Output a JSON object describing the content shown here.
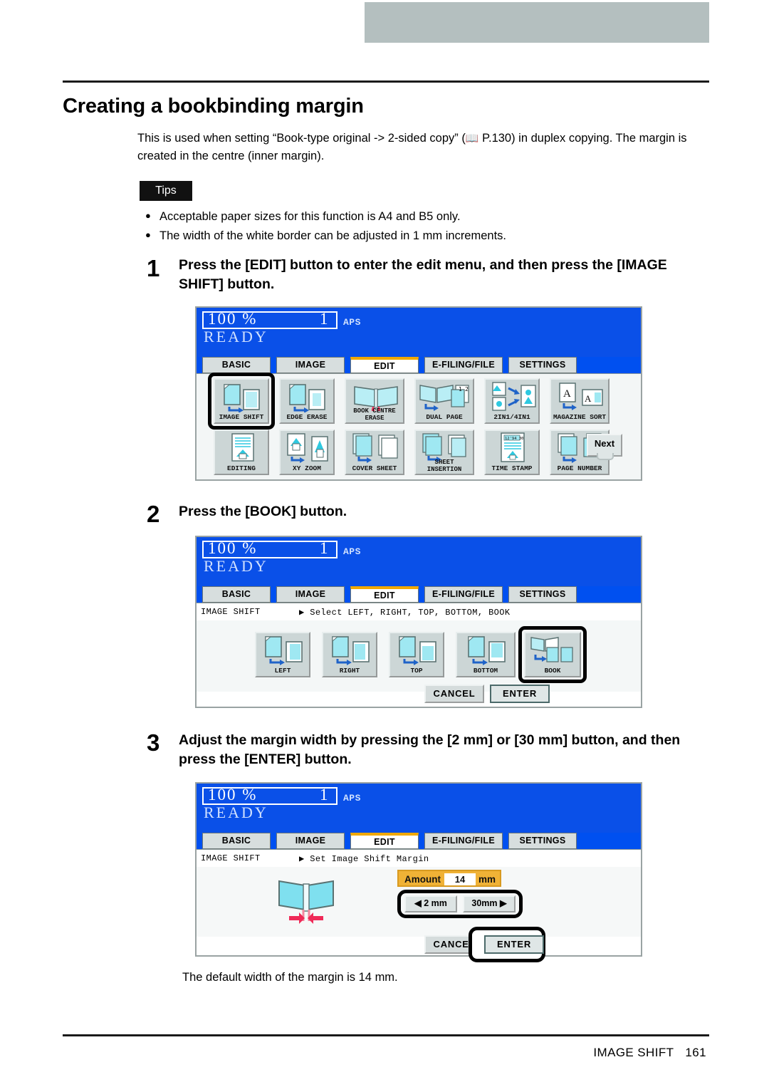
{
  "page_title": "Creating a bookbinding margin",
  "intro": "This is used when setting “Book-type original -> 2-sided copy” (  P.130) in duplex copying. The margin is created in the centre (inner margin).",
  "tips": {
    "label": "Tips",
    "items": [
      "Acceptable paper sizes for this function is A4 and B5 only.",
      "The width of the white border can be adjusted in 1 mm increments."
    ]
  },
  "steps": [
    {
      "num": "1",
      "text": "Press the [EDIT] button to enter the edit menu, and then press the [IMAGE SHIFT] button."
    },
    {
      "num": "2",
      "text": "Press the [BOOK] button."
    },
    {
      "num": "3",
      "text": "Adjust the margin width by pressing the [2 mm] or [30 mm] button, and then press the [ENTER] button."
    }
  ],
  "lcd_common": {
    "ratio": "100  %",
    "copies": "1",
    "aps": "APS",
    "status": "READY",
    "tabs": [
      {
        "label": "BASIC",
        "active": false
      },
      {
        "label": "IMAGE",
        "active": false
      },
      {
        "label": "EDIT",
        "active": true
      },
      {
        "label": "E-FILING/FILE",
        "active": false
      },
      {
        "label": "SETTINGS",
        "active": false
      }
    ]
  },
  "panel1": {
    "row1": [
      {
        "label": "IMAGE SHIFT",
        "icon": "image-shift-icon",
        "highlighted": true
      },
      {
        "label": "EDGE ERASE",
        "icon": "edge-erase-icon",
        "highlighted": false
      },
      {
        "label": "BOOK CENTRE ERASE",
        "icon": "book-centre-erase-icon",
        "highlighted": false
      },
      {
        "label": "DUAL  PAGE",
        "icon": "dual-page-icon",
        "highlighted": false
      },
      {
        "label": "2IN1/4IN1",
        "icon": "2in1-4in1-icon",
        "highlighted": false
      },
      {
        "label": "MAGAZINE SORT",
        "icon": "magazine-sort-icon",
        "highlighted": false
      }
    ],
    "row2": [
      {
        "label": "EDITING",
        "icon": "editing-icon",
        "highlighted": false
      },
      {
        "label": "XY ZOOM",
        "icon": "xy-zoom-icon",
        "highlighted": false
      },
      {
        "label": "COVER SHEET",
        "icon": "cover-sheet-icon",
        "highlighted": false
      },
      {
        "label": "SHEET INSERTION",
        "icon": "sheet-insertion-icon",
        "highlighted": false
      },
      {
        "label": "TIME STAMP",
        "icon": "time-stamp-icon",
        "highlighted": false
      },
      {
        "label": "PAGE NUMBER",
        "icon": "page-number-icon",
        "highlighted": false
      }
    ],
    "next_label": "Next"
  },
  "panel2": {
    "feature_label": "IMAGE SHIFT",
    "hint": "▶ Select LEFT, RIGHT, TOP, BOTTOM, BOOK",
    "buttons": [
      {
        "label": "LEFT",
        "icon": "shift-left-icon",
        "highlighted": false
      },
      {
        "label": "RIGHT",
        "icon": "shift-right-icon",
        "highlighted": false
      },
      {
        "label": "TOP",
        "icon": "shift-top-icon",
        "highlighted": false
      },
      {
        "label": "BOTTOM",
        "icon": "shift-bottom-icon",
        "highlighted": false
      },
      {
        "label": "BOOK",
        "icon": "shift-book-icon",
        "highlighted": true
      }
    ],
    "cancel_label": "CANCEL",
    "enter_label": "ENTER"
  },
  "panel3": {
    "feature_label": "IMAGE SHIFT",
    "hint": "▶ Set Image Shift Margin",
    "amount_label": "Amount :",
    "amount_value": "14",
    "amount_unit": "mm",
    "dec_label": "2 mm",
    "inc_label": "30mm",
    "cancel_label": "CANCEL",
    "enter_label": "ENTER"
  },
  "note": "The default width of the margin is 14 mm.",
  "footer": {
    "section": "IMAGE SHIFT",
    "page": "161"
  },
  "colors": {
    "lcd_blue": "#0050f0",
    "tab_active_accent": "#f0a800",
    "amount_bg": "#f0b236",
    "highlight_ring": "#000000",
    "icon_cyan": "#7fe0ef",
    "arrow_blue": "#1f63c8",
    "arrow_pink": "#f0325c"
  }
}
